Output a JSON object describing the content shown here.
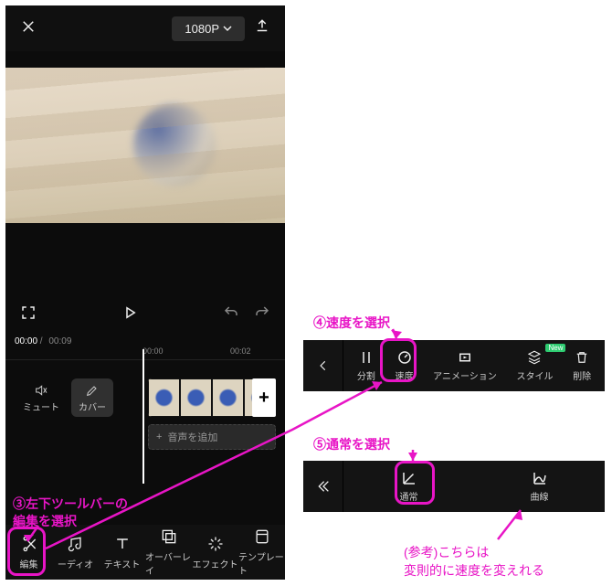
{
  "topbar": {
    "resolution": "1080P"
  },
  "timecodes": {
    "current": "00:00",
    "total": "00:09",
    "tick_mid": "00:00",
    "tick_right": "00:02"
  },
  "mini": {
    "mute": "ミュート",
    "cover": "カバー"
  },
  "audio_row": "音声を追加",
  "toolbar": {
    "edit": "編集",
    "audio": "ーディオ",
    "text": "テキスト",
    "overlay": "オーバーレイ",
    "effect": "エフェクト",
    "template": "テンプレート"
  },
  "panel1": {
    "split": "分割",
    "speed": "速度",
    "animation": "アニメーション",
    "style": "スタイル",
    "style_badge": "New",
    "delete": "削除"
  },
  "panel2": {
    "normal": "通常",
    "curve": "曲線"
  },
  "annotations": {
    "step3_line1": "③左下ツールバーの",
    "step3_line2": "編集を選択",
    "step4": "④速度を選択",
    "step5": "⑤通常を選択",
    "ref_line1": "(参考)こちらは",
    "ref_line2": "変則的に速度を変えれる"
  }
}
